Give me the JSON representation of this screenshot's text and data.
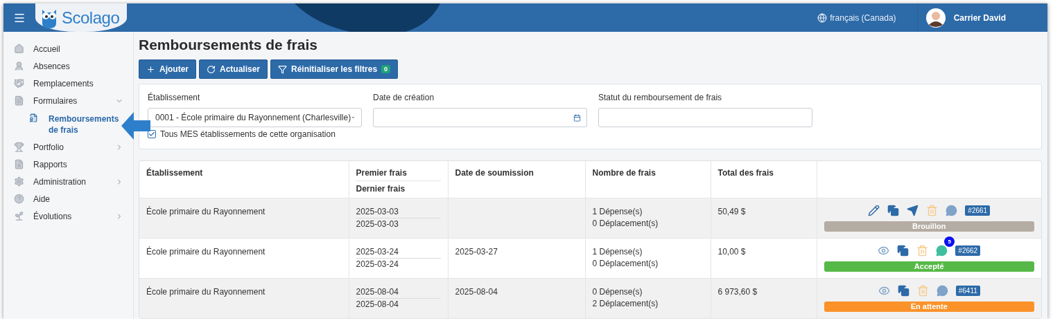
{
  "topbar": {
    "logo": "Scolago",
    "language": "français (Canada)",
    "user": "Carrier David"
  },
  "sidebar": {
    "items": [
      {
        "label": "Accueil",
        "kind": "link",
        "selected": false
      },
      {
        "label": "Absences",
        "kind": "link",
        "selected": false
      },
      {
        "label": "Remplacements",
        "kind": "link",
        "selected": false
      },
      {
        "label": "Formulaires",
        "kind": "group",
        "expanded": true,
        "selected": false,
        "children": [
          {
            "label": "Remboursements de frais",
            "kind": "link",
            "selected": true
          }
        ]
      },
      {
        "label": "Portfolio",
        "kind": "group",
        "expanded": false,
        "selected": false
      },
      {
        "label": "Rapports",
        "kind": "link",
        "selected": false
      },
      {
        "label": "Administration",
        "kind": "group",
        "expanded": false,
        "selected": false
      },
      {
        "label": "Aide",
        "kind": "link",
        "selected": false
      },
      {
        "label": "Évolutions",
        "kind": "group",
        "expanded": false,
        "selected": false
      }
    ]
  },
  "page": {
    "title": "Remboursements de frais"
  },
  "toolbar": [
    {
      "label": "Ajouter",
      "kind": "add"
    },
    {
      "label": "Actualiser",
      "kind": "refresh"
    },
    {
      "label": "Réinitialiser les filtres",
      "kind": "filter",
      "badge": "0"
    }
  ],
  "filters": {
    "fields": [
      {
        "label": "Établissement",
        "kind": "select",
        "value": "0001 - École primaire du Rayonnement (Charlesville)"
      },
      {
        "label": "Date de création",
        "kind": "date"
      },
      {
        "label": "Statut du remboursement de frais",
        "kind": "text"
      }
    ],
    "checkbox": {
      "label": "Tous MES établissements de cette organisation",
      "checked": true
    }
  },
  "table": {
    "columns": [
      {
        "label": "Établissement"
      },
      {
        "label": "Premier frais",
        "sublabel": "Dernier frais"
      },
      {
        "label": "Date de soumission"
      },
      {
        "label": "Nombre de frais"
      },
      {
        "label": "Total des frais"
      }
    ],
    "rows": [
      {
        "establishment": "École primaire du Rayonnement",
        "first": "2025-03-03",
        "last": "2025-03-03",
        "expenses": "1 Dépense(s)",
        "trips": "0 Déplacement(s)",
        "total": "50,49 $",
        "actions": [
          {
            "kind": "edit"
          },
          {
            "kind": "copy"
          },
          {
            "kind": "send"
          },
          {
            "kind": "delete"
          },
          {
            "kind": "comment"
          }
        ],
        "id": "#2661",
        "status": {
          "label": "Brouillon",
          "color": "#b5aca3"
        }
      },
      {
        "establishment": "École primaire du Rayonnement",
        "first": "2025-03-24",
        "last": "2025-03-24",
        "submitted": "2025-03-27",
        "expenses": "1 Dépense(s)",
        "trips": "0 Déplacement(s)",
        "total": "10,00 $",
        "actions": [
          {
            "kind": "view"
          },
          {
            "kind": "copy"
          },
          {
            "kind": "delete"
          },
          {
            "kind": "comment",
            "badge": "5"
          }
        ],
        "id": "#2662",
        "status": {
          "label": "Accepté",
          "color": "#56b947"
        }
      },
      {
        "establishment": "École primaire du Rayonnement",
        "first": "2025-08-04",
        "last": "2025-08-04",
        "submitted": "2025-08-04",
        "expenses": "0 Dépense(s)",
        "trips": "2 Déplacement(s)",
        "total": "6 973,60 $",
        "actions": [
          {
            "kind": "view"
          },
          {
            "kind": "copy"
          },
          {
            "kind": "delete"
          },
          {
            "kind": "comment"
          }
        ],
        "id": "#6411",
        "status": {
          "label": "En attente",
          "color": "#fb9229"
        }
      }
    ]
  }
}
